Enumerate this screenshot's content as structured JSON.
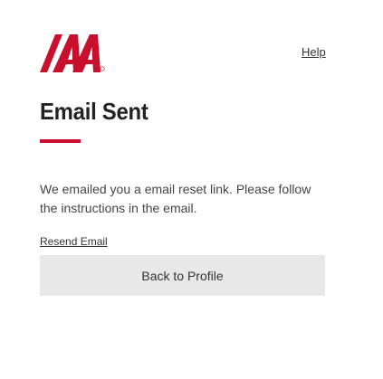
{
  "header": {
    "logo_name": "iaa-logo",
    "help_label": "Help"
  },
  "main": {
    "title": "Email Sent",
    "message": "We emailed you a email reset link. Please follow the instructions in the email.",
    "resend_label": "Resend Email",
    "back_button_label": "Back to Profile"
  },
  "colors": {
    "brand_red": "#c8102e",
    "button_bg": "#e8e8e8",
    "text": "#333333"
  }
}
